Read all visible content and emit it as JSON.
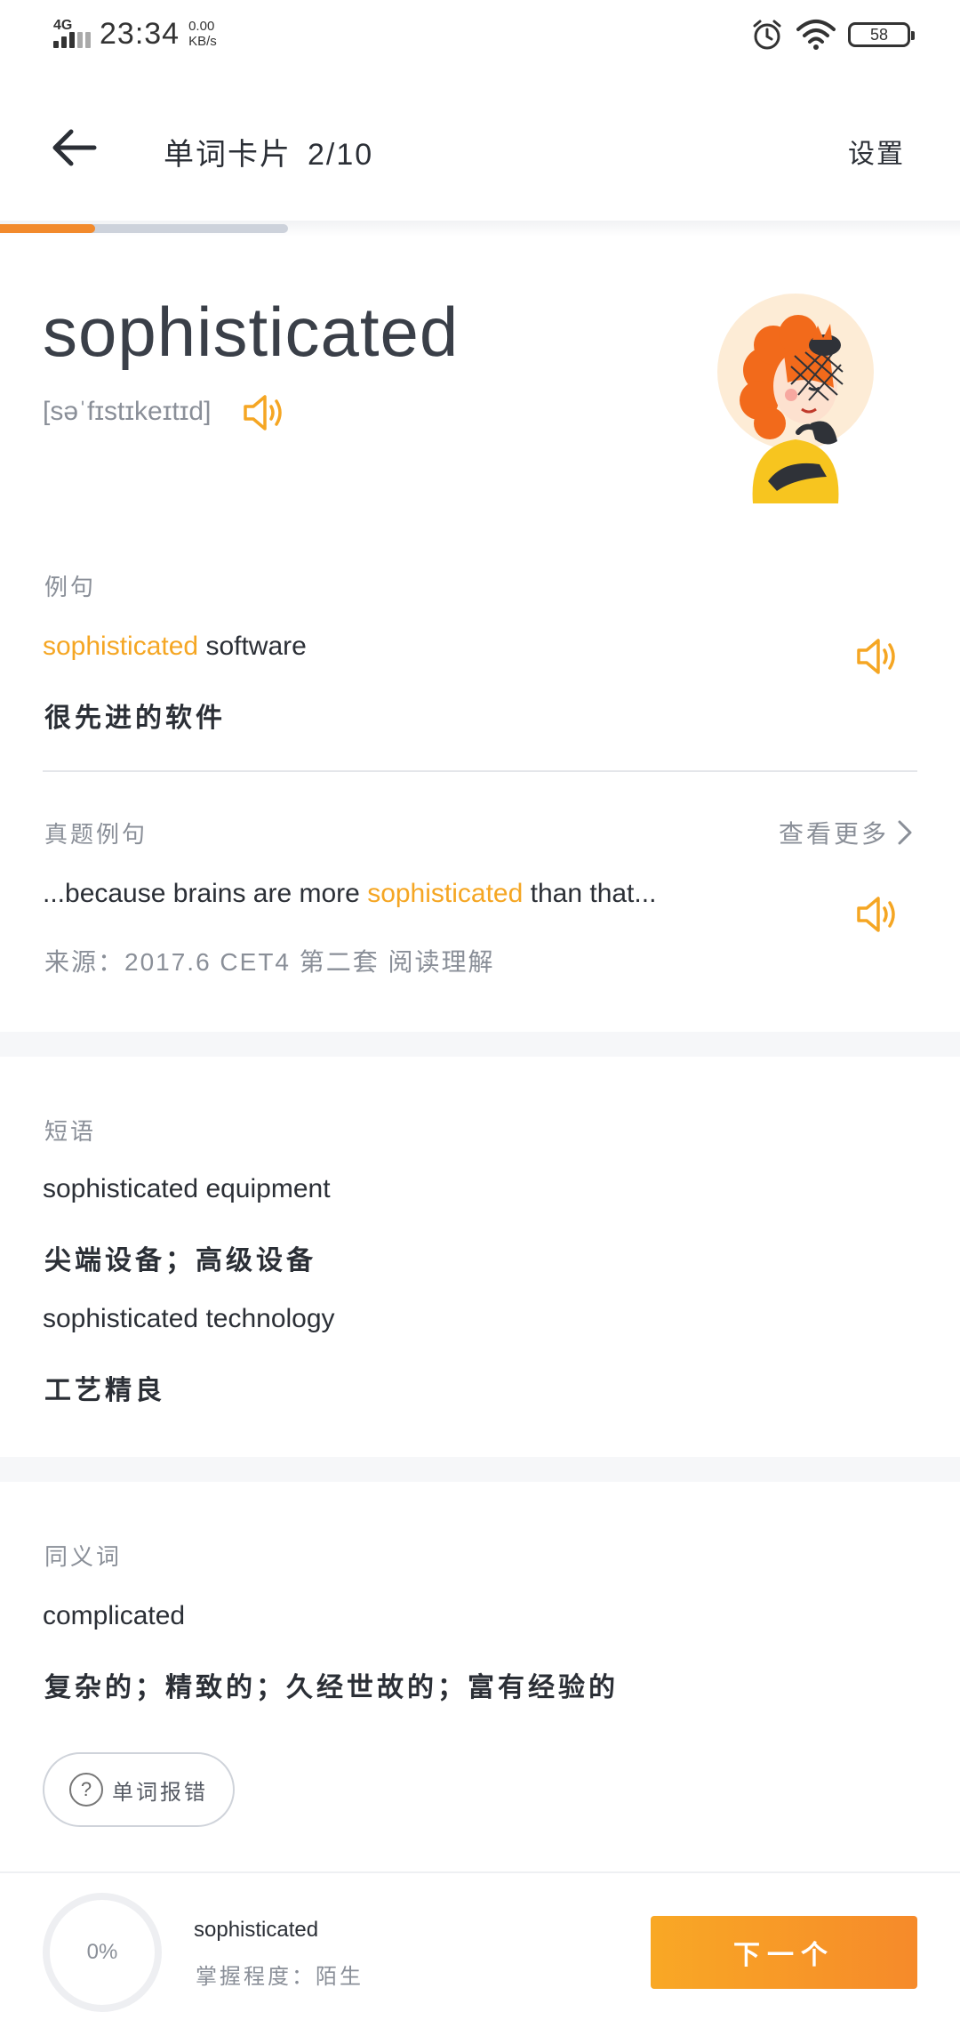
{
  "status_bar": {
    "network": "4G",
    "time": "23:34",
    "speed_value": "0.00",
    "speed_unit": "KB/s",
    "battery": "58"
  },
  "header": {
    "title": "单词卡片",
    "count": "2/10",
    "settings": "设置",
    "progress": 0.33
  },
  "word": {
    "text": "sophisticated",
    "phonetic": "[səˈfɪstɪkeɪtɪd]"
  },
  "example": {
    "label": "例句",
    "en_highlight": "sophisticated",
    "en_rest": " software",
    "cn": "很先进的软件"
  },
  "exam_example": {
    "label": "真题例句",
    "more": "查看更多",
    "en_before": "...because brains are more ",
    "en_highlight": "sophisticated",
    "en_after": " than that...",
    "source": "来源：2017.6 CET4 第二套 阅读理解"
  },
  "phrases": {
    "label": "短语",
    "items": [
      {
        "en": "sophisticated equipment",
        "cn": "尖端设备；高级设备"
      },
      {
        "en": "sophisticated technology",
        "cn": "工艺精良"
      }
    ]
  },
  "synonyms": {
    "label": "同义词",
    "word": "complicated",
    "cn": "复杂的；精致的；久经世故的；富有经验的"
  },
  "report": {
    "label": "单词报错",
    "icon": "?"
  },
  "footer": {
    "percent": "0%",
    "word": "sophisticated",
    "mastery": "掌握程度：陌生",
    "next": "下一个"
  },
  "colors": {
    "accent": "#f5a623",
    "progress": "#f28a2c"
  }
}
